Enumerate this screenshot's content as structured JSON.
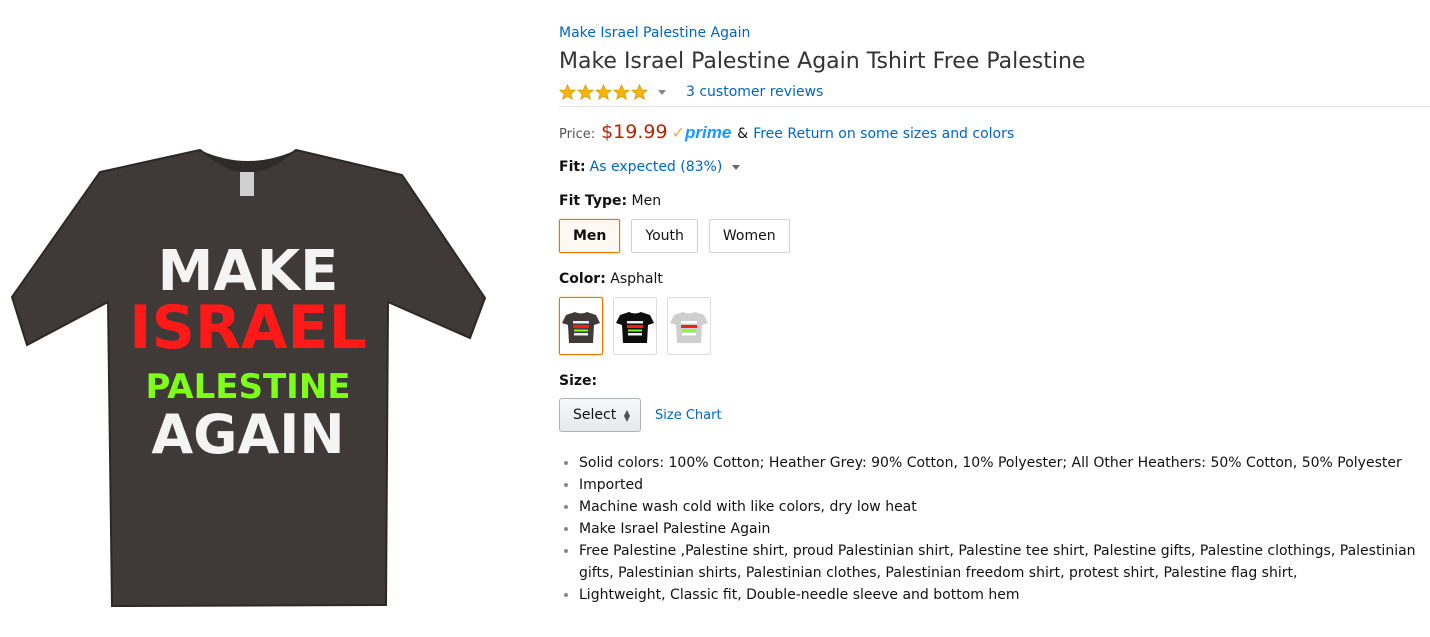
{
  "product": {
    "brand_link": "Make Israel Palestine Again",
    "title": "Make Israel Palestine Again Tshirt Free Palestine",
    "reviews_link": "3 customer reviews",
    "rating": 5,
    "shirt_print": [
      "MAKE",
      "ISRAEL",
      "PALESTINE",
      "AGAIN"
    ]
  },
  "price": {
    "label": "Price:",
    "value": "$19.99",
    "prime": "prime",
    "amp": "&",
    "free_return": "Free Return on some sizes and colors"
  },
  "fit": {
    "label": "Fit:",
    "value": "As expected (83%)"
  },
  "fit_type": {
    "label": "Fit Type:",
    "selected": "Men",
    "options": [
      "Men",
      "Youth",
      "Women"
    ]
  },
  "color": {
    "label": "Color:",
    "selected": "Asphalt",
    "swatches": [
      "asphalt",
      "black",
      "heather-grey"
    ]
  },
  "size": {
    "label": "Size:",
    "select_value": "Select",
    "size_chart": "Size Chart"
  },
  "bullets": [
    "Solid colors: 100% Cotton; Heather Grey: 90% Cotton, 10% Polyester; All Other Heathers: 50% Cotton, 50% Polyester",
    "Imported",
    "Machine wash cold with like colors, dry low heat",
    "Make Israel Palestine Again",
    "Free Palestine ,Palestine shirt, proud Palestinian shirt, Palestine tee shirt, Palestine gifts, Palestine clothings, Palestinian gifts, Palestinian shirts, Palestinian clothes, Palestinian freedom shirt, protest shirt, Palestine flag shirt,",
    "Lightweight, Classic fit, Double-needle sleeve and bottom hem"
  ],
  "colors": {
    "link": "#0066c0",
    "price": "#b12704",
    "selected_border": "#e77600",
    "shirt_asphalt": "#3f3a37",
    "print_white": "#f4f4f4",
    "print_red": "#ff1a1a",
    "print_green": "#7dff1a"
  }
}
